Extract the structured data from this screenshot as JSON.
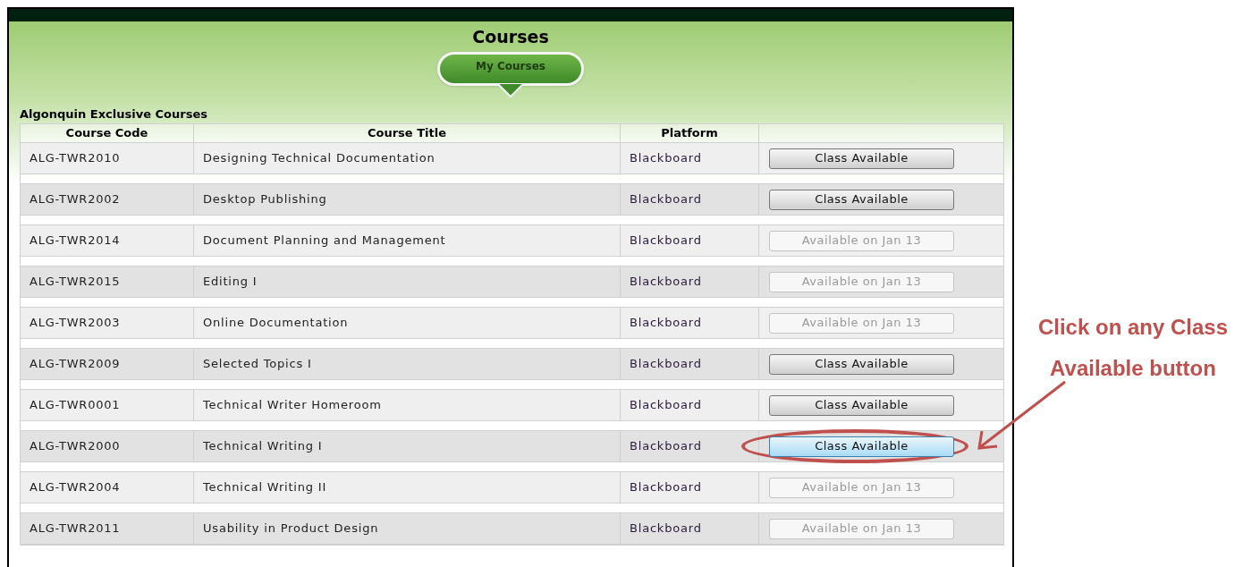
{
  "page": {
    "title": "Courses",
    "tab": {
      "label": "My Courses",
      "selected": true
    }
  },
  "section_title": "Algonquin Exclusive Courses",
  "table": {
    "columns": [
      "Course Code",
      "Course Title",
      "Platform"
    ],
    "rows": [
      {
        "code": "ALG-TWR2010",
        "title": "Designing Technical Documentation",
        "platform": "Blackboard",
        "action": {
          "label": "Class Available",
          "kind": "open",
          "highlighted": false
        }
      },
      {
        "code": "ALG-TWR2002",
        "title": "Desktop Publishing",
        "platform": "Blackboard",
        "action": {
          "label": "Class Available",
          "kind": "open",
          "highlighted": false
        }
      },
      {
        "code": "ALG-TWR2014",
        "title": "Document Planning and Management",
        "platform": "Blackboard",
        "action": {
          "label": "Available on Jan 13",
          "kind": "locked",
          "highlighted": false
        }
      },
      {
        "code": "ALG-TWR2015",
        "title": "Editing I",
        "platform": "Blackboard",
        "action": {
          "label": "Available on Jan 13",
          "kind": "locked",
          "highlighted": false
        }
      },
      {
        "code": "ALG-TWR2003",
        "title": "Online Documentation",
        "platform": "Blackboard",
        "action": {
          "label": "Available on Jan 13",
          "kind": "locked",
          "highlighted": false
        }
      },
      {
        "code": "ALG-TWR2009",
        "title": "Selected Topics I",
        "platform": "Blackboard",
        "action": {
          "label": "Class Available",
          "kind": "open",
          "highlighted": false
        }
      },
      {
        "code": "ALG-TWR0001",
        "title": "Technical Writer Homeroom",
        "platform": "Blackboard",
        "action": {
          "label": "Class Available",
          "kind": "open",
          "highlighted": false
        }
      },
      {
        "code": "ALG-TWR2000",
        "title": "Technical Writing I",
        "platform": "Blackboard",
        "action": {
          "label": "Class Available",
          "kind": "open",
          "highlighted": true
        }
      },
      {
        "code": "ALG-TWR2004",
        "title": "Technical Writing II",
        "platform": "Blackboard",
        "action": {
          "label": "Available on Jan 13",
          "kind": "locked",
          "highlighted": false
        }
      },
      {
        "code": "ALG-TWR2011",
        "title": "Usability in Product Design",
        "platform": "Blackboard",
        "action": {
          "label": "Available on Jan 13",
          "kind": "locked",
          "highlighted": false
        }
      }
    ]
  },
  "annotation": {
    "lines": [
      "Click on any Class",
      "Available button"
    ]
  }
}
